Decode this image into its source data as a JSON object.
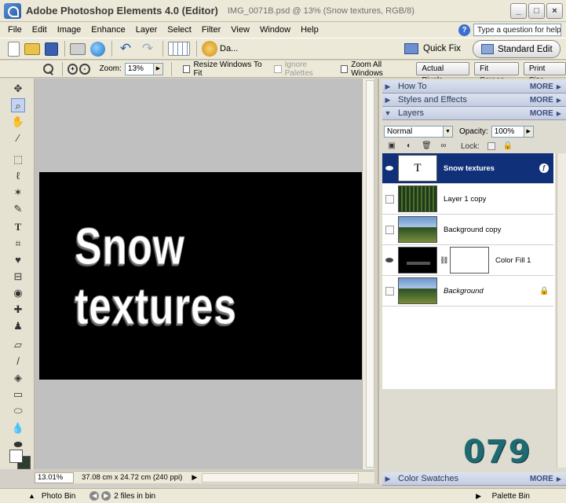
{
  "window": {
    "app_title": "Adobe Photoshop Elements 4.0 (Editor)",
    "doc_title": "IMG_0071B.psd @ 13% (Snow textures, RGB/8)"
  },
  "menu": {
    "items": [
      "File",
      "Edit",
      "Image",
      "Enhance",
      "Layer",
      "Select",
      "Filter",
      "View",
      "Window",
      "Help"
    ],
    "help_placeholder": "Type a question for help"
  },
  "shortcuts": {
    "date_label": "Da...",
    "quick_fix": "Quick Fix",
    "standard_edit": "Standard Edit"
  },
  "options": {
    "zoom_label": "Zoom:",
    "zoom_value": "13%",
    "resize_windows": "Resize Windows To Fit",
    "ignore_palettes": "Ignore Palettes",
    "zoom_all_windows": "Zoom All Windows",
    "actual_pixels": "Actual Pixels",
    "fit_screen": "Fit Screen",
    "print_size": "Print Size"
  },
  "canvas": {
    "image_text": "Snow textures"
  },
  "status": {
    "zoom": "13.01%",
    "info": "37.08 cm x 24.72 cm (240 ppi)"
  },
  "palettes": {
    "how_to": "How To",
    "styles_effects": "Styles and Effects",
    "layers": "Layers",
    "color_swatches": "Color Swatches",
    "more": "MORE"
  },
  "layers_panel": {
    "blend_mode": "Normal",
    "opacity_label": "Opacity:",
    "opacity_value": "100%",
    "lock_label": "Lock:",
    "layers": [
      {
        "name": "Snow textures",
        "thumb": "T"
      },
      {
        "name": "Layer 1 copy"
      },
      {
        "name": "Background copy"
      },
      {
        "name": "Color Fill 1"
      },
      {
        "name": "Background"
      }
    ]
  },
  "photo_bin": {
    "label": "Photo Bin",
    "count": "2 files in bin",
    "palette_bin": "Palette Bin"
  },
  "watermark_number": "079",
  "colors": {
    "selected_layer": "#10317a",
    "canvas_bg": "#c0c0c0",
    "watermark": "#1f6a70"
  }
}
